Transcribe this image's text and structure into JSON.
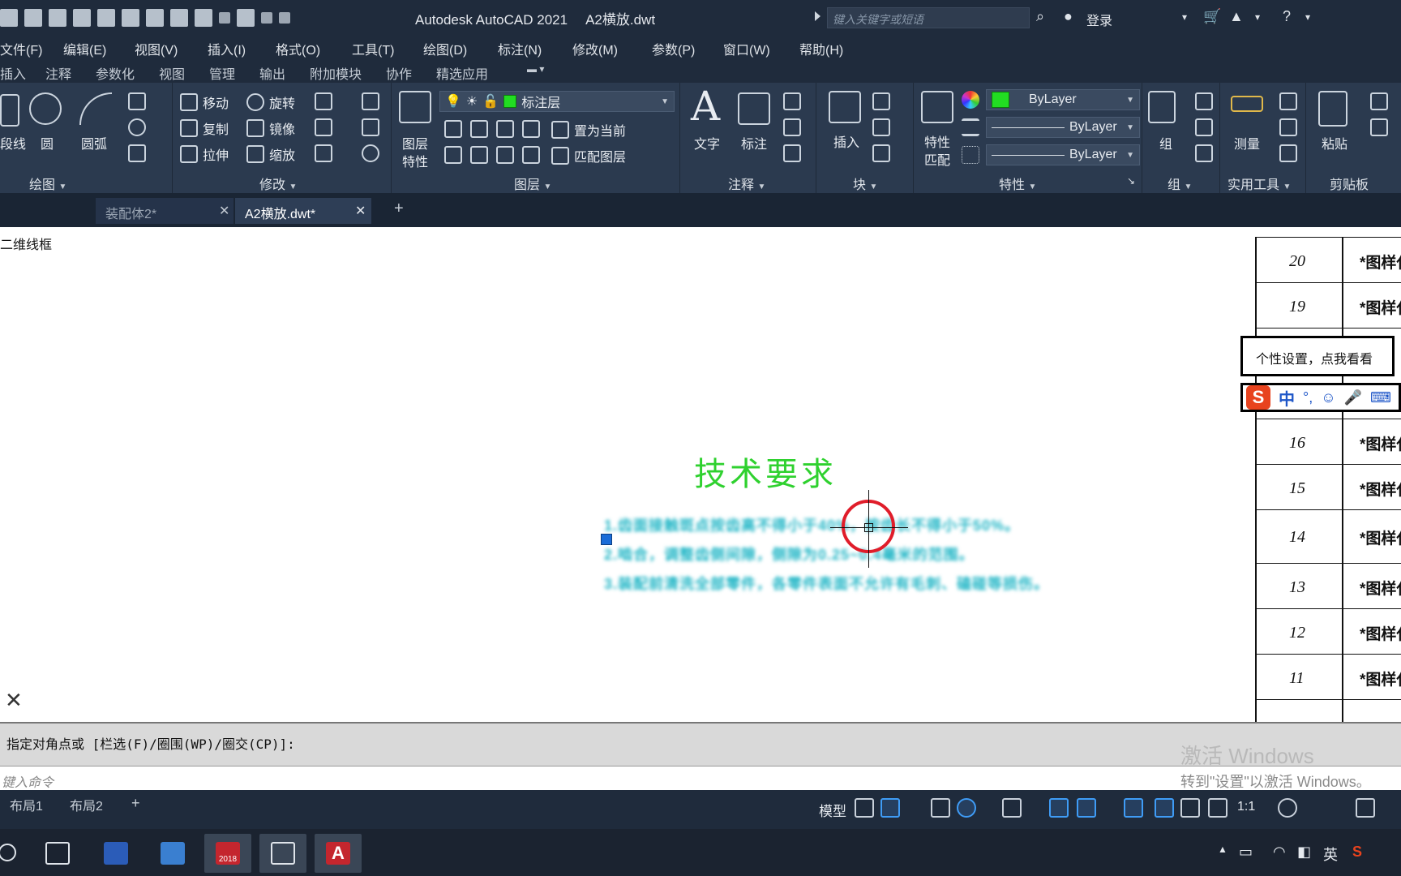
{
  "window": {
    "app_title": "Autodesk AutoCAD 2021",
    "file_title": "A2横放.dwt",
    "search_placeholder": "键入关键字或短语",
    "login_label": "登录"
  },
  "menu": [
    "文件(F)",
    "编辑(E)",
    "视图(V)",
    "插入(I)",
    "格式(O)",
    "工具(T)",
    "绘图(D)",
    "标注(N)",
    "修改(M)",
    "参数(P)",
    "窗口(W)",
    "帮助(H)"
  ],
  "ribbon_tabs": [
    "插入",
    "注释",
    "参数化",
    "视图",
    "管理",
    "输出",
    "附加模块",
    "协作",
    "精选应用"
  ],
  "ribbon": {
    "draw": {
      "title": "绘图",
      "polyline": "段线",
      "circle": "圆",
      "arc": "圆弧"
    },
    "modify": {
      "title": "修改",
      "move": "移动",
      "rotate": "旋转",
      "copy": "复制",
      "mirror": "镜像",
      "stretch": "拉伸",
      "scale": "缩放"
    },
    "layers": {
      "title": "图层",
      "props_label_1": "图层",
      "props_label_2": "特性",
      "current_layer": "标注层",
      "set_current": "置为当前",
      "match_layer": "匹配图层"
    },
    "annotation": {
      "title": "注释",
      "text": "文字",
      "dimension": "标注"
    },
    "block": {
      "title": "块",
      "insert": "插入"
    },
    "properties": {
      "title": "特性",
      "match_1": "特性",
      "match_2": "匹配",
      "color": "ByLayer",
      "linetype": "ByLayer",
      "lineweight": "ByLayer"
    },
    "group": {
      "title": "组",
      "group": "组"
    },
    "utilities": {
      "title": "实用工具",
      "measure": "测量"
    },
    "clipboard": {
      "title": "剪贴板",
      "paste": "粘贴"
    }
  },
  "doc_tabs": [
    {
      "label": "装配体2*",
      "active": false
    },
    {
      "label": "A2横放.dwt*",
      "active": true
    }
  ],
  "canvas": {
    "view_label": "二维线框",
    "tech_title": "技术要求",
    "tech_lines": [
      "1.齿面接触斑点按齿高不得小于40%，按齿长不得小于50%。",
      "2.啮合，调整齿侧间隙，侧隙为0.25~0.4毫米的范围。",
      "3.装配前清洗全部零件，各零件表面不允许有毛刺、磕碰等损伤。"
    ]
  },
  "table_rows": [
    {
      "num": "20",
      "text": "*图样代号"
    },
    {
      "num": "19",
      "text": "*图样代号"
    },
    {
      "num": "16",
      "text": "*图样代号"
    },
    {
      "num": "15",
      "text": "*图样代号"
    },
    {
      "num": "14",
      "text": "*图样代号"
    },
    {
      "num": "13",
      "text": "*图样代号"
    },
    {
      "num": "12",
      "text": "*图样代号"
    },
    {
      "num": "11",
      "text": "*图样代号"
    }
  ],
  "ime": {
    "tip": "个性设置，点我看看",
    "mode": "中",
    "logo": "S"
  },
  "command": {
    "prompt": "指定对角点或 [栏选(F)/圈围(WP)/圈交(CP)]:",
    "input_placeholder": "键入命令"
  },
  "watermark": {
    "line1": "激活 Windows",
    "line2": "转到\"设置\"以激活 Windows。"
  },
  "status": {
    "layout_tabs": [
      "布局1",
      "布局2"
    ],
    "add_tab": "+",
    "model": "模型",
    "scale": "1:1"
  },
  "taskbar": {
    "tray_lang": "英",
    "sw_badge": "2018"
  },
  "colors": {
    "chrome_dark": "#1f2b3c",
    "ribbon_bg": "#2b3a4f",
    "layer_color": "#22dd22",
    "tech_title_color": "#2fd12f",
    "tech_text_color": "#22b6c6",
    "cursor_red": "#e01d2a"
  }
}
